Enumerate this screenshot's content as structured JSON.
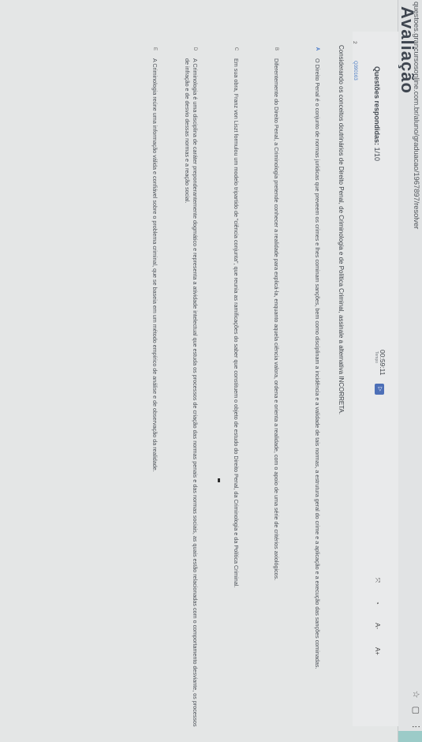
{
  "browser": {
    "url": "questoes.grancursosonline.com.br/aluno/graduacao/1967897/resolver"
  },
  "page": {
    "title": "Avaliação"
  },
  "header": {
    "answered_label": "Questões respondidas:",
    "answered_count": "1/10",
    "timer_value": "00:59:11",
    "timer_label": "Tempo",
    "tools": [
      "⤧",
      "◔",
      "A-",
      "A+"
    ]
  },
  "question": {
    "number": "2",
    "code": "Q390163",
    "statement": "Considerando os conceitos doutrinários de Direito Penal, de Criminologia e de Política Criminal, assinale a alternativa INCORRETA.",
    "alternatives": [
      {
        "letter": "A",
        "text": "O Direito Penal é o conjunto de normas jurídicas que preveem os crimes e lhes cominam sanções, bem como disciplinam a incidência e a validade de tais normas, a estrutura geral do crime e a aplicação e a execução das sanções cominadas."
      },
      {
        "letter": "B",
        "text": "Diferentemente do Direito Penal, a Criminologia pretende conhecer a realidade para explicá-la, enquanto aquela ciência valora, ordena e orienta a realidade, com o apoio de uma série de critérios axiológicos."
      },
      {
        "letter": "C",
        "text": "Em sua obra, Franz von Liszt formulou um modelo tripartido de \"ciência conjunta\", que reunia as ramificações do saber que constituem o objeto de estudo do Direito Penal, da Criminologia e da Política Criminal."
      },
      {
        "letter": "D",
        "text": "A Criminologia é uma disciplina de caráter preponderantemente dogmático e representa a atividade intelectual que estuda os processos de criação das normas penais e das normas sociais, as quais estão relacionadas com o comportamento desviante, os processos de infração e de desvio dessas normas e a reação social."
      },
      {
        "letter": "E",
        "text": "A Criminologia reúne uma informação válida e confiável sobre o problema criminal, que se baseia em um método empírico de análise e de observação da realidade."
      }
    ]
  }
}
